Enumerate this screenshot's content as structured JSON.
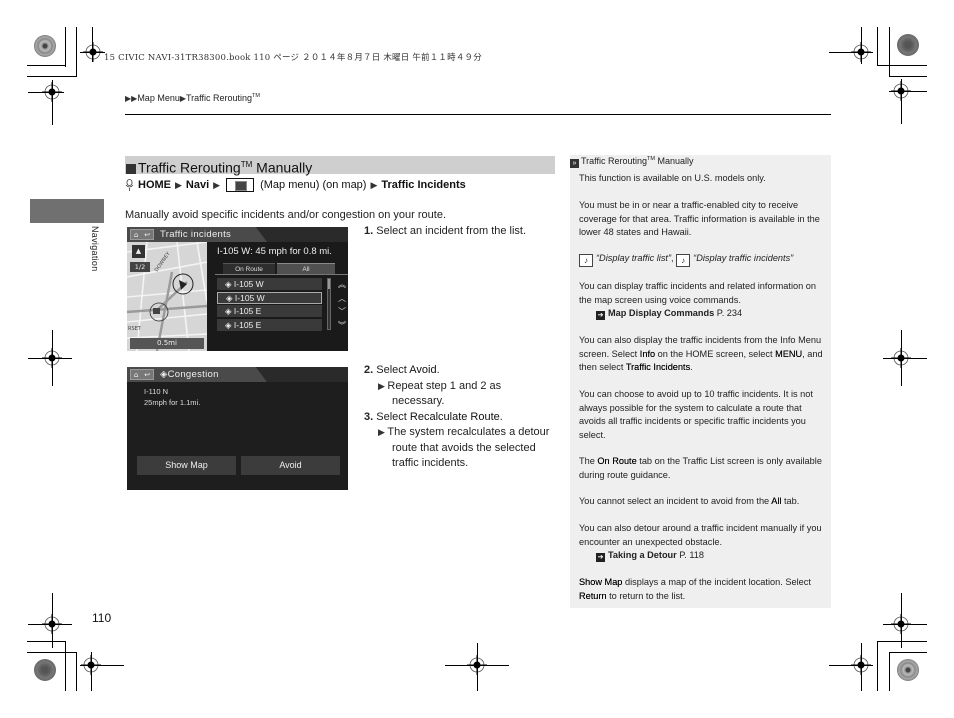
{
  "print_header": "15 CIVIC NAVI-31TR38300.book  110 ページ  ２０１４年８月７日  木曜日  午前１１時４９分",
  "breadcrumb": {
    "items": [
      "Map Menu",
      "Traffic Rerouting"
    ],
    "tm": "TM"
  },
  "side_tab": {
    "label": "Navigation"
  },
  "section": {
    "title_prefix": "Traffic Rerouting",
    "title_tm": "TM",
    "title_suffix": " Manually"
  },
  "nav_path": {
    "home": "HOME",
    "navi": "Navi",
    "map_menu_text": "(Map menu) (on map)",
    "target": "Traffic Incidents"
  },
  "intro": "Manually avoid specific incidents and/or congestion on your route.",
  "screen1": {
    "title": "Traffic incidents",
    "incident_info": "I-105 W: 45 mph for 0.8 mi.",
    "tabs": [
      "On Route",
      "All"
    ],
    "active_tab": "All",
    "items": [
      "I-105 W",
      "I-105 W",
      "I-105 E",
      "I-105 E"
    ],
    "selected_index": 1,
    "map_zoom": "1/2",
    "map_zoom_unit": "mi",
    "map_scale": "0.5mi",
    "map_street": "DOWNEY",
    "map_street2": "RSET",
    "scroll_arrows": [
      "⋀⋀",
      "∧",
      "∨",
      "⋁⋁"
    ]
  },
  "screen2": {
    "title": "Congestion",
    "road": "I-110 N",
    "detail": "25mph for 1.1mi.",
    "buttons": [
      "Show Map",
      "Avoid"
    ]
  },
  "steps": [
    {
      "num": "1.",
      "text": "Select an incident from the list."
    },
    {
      "num": "2.",
      "text": "Select ",
      "sel": "Avoid",
      "after": ".",
      "sub": "Repeat step 1 and 2 as necessary."
    },
    {
      "num": "3.",
      "text": "Select ",
      "sel": "Recalculate Route",
      "after": ".",
      "sub": "The system recalculates a detour route that avoids the selected traffic incidents."
    }
  ],
  "note": {
    "head_prefix": "Traffic Rerouting",
    "head_tm": "TM",
    "head_suffix": " Manually",
    "p1": "This function is available on U.S. models only.",
    "p2": "You must be in or near a traffic-enabled city to receive coverage for that area. Traffic information is available in the lower 48 states and Hawaii.",
    "voice1": "“Display traffic list”",
    "voice_sep": ",",
    "voice2": "“Display traffic incidents”",
    "p3": "You can display traffic incidents and related information on the map screen using voice commands.",
    "ref1_label": "Map Display Commands",
    "ref1_page": " P. 234",
    "p4a": "You can also display the traffic incidents from the Info Menu screen. Select ",
    "p4_info": "Info",
    "p4b": " on the HOME screen, select ",
    "p4_menu": "MENU",
    "p4c": ", and then select ",
    "p4_ti": "Traffic Incidents",
    "p4d": ".",
    "p5": "You can choose to avoid up to 10 traffic incidents. It is not always possible for the system to calculate a route that avoids all traffic incidents or specific traffic incidents you select.",
    "p6a": "The ",
    "p6_onroute": "On Route",
    "p6b": " tab on the Traffic List screen is only available during route guidance.",
    "p7a": "You cannot select an incident to avoid from the ",
    "p7_all": "All",
    "p7b": " tab.",
    "p8": "You can also detour around a traffic incident manually if you encounter an unexpected obstacle.",
    "ref2_label": "Taking a Detour",
    "ref2_page": " P. 118",
    "p9_showmap": "Show Map",
    "p9a": " displays a map of the incident location. Select ",
    "p9_return": "Return",
    "p9b": " to return to the list."
  },
  "page_number": "110"
}
